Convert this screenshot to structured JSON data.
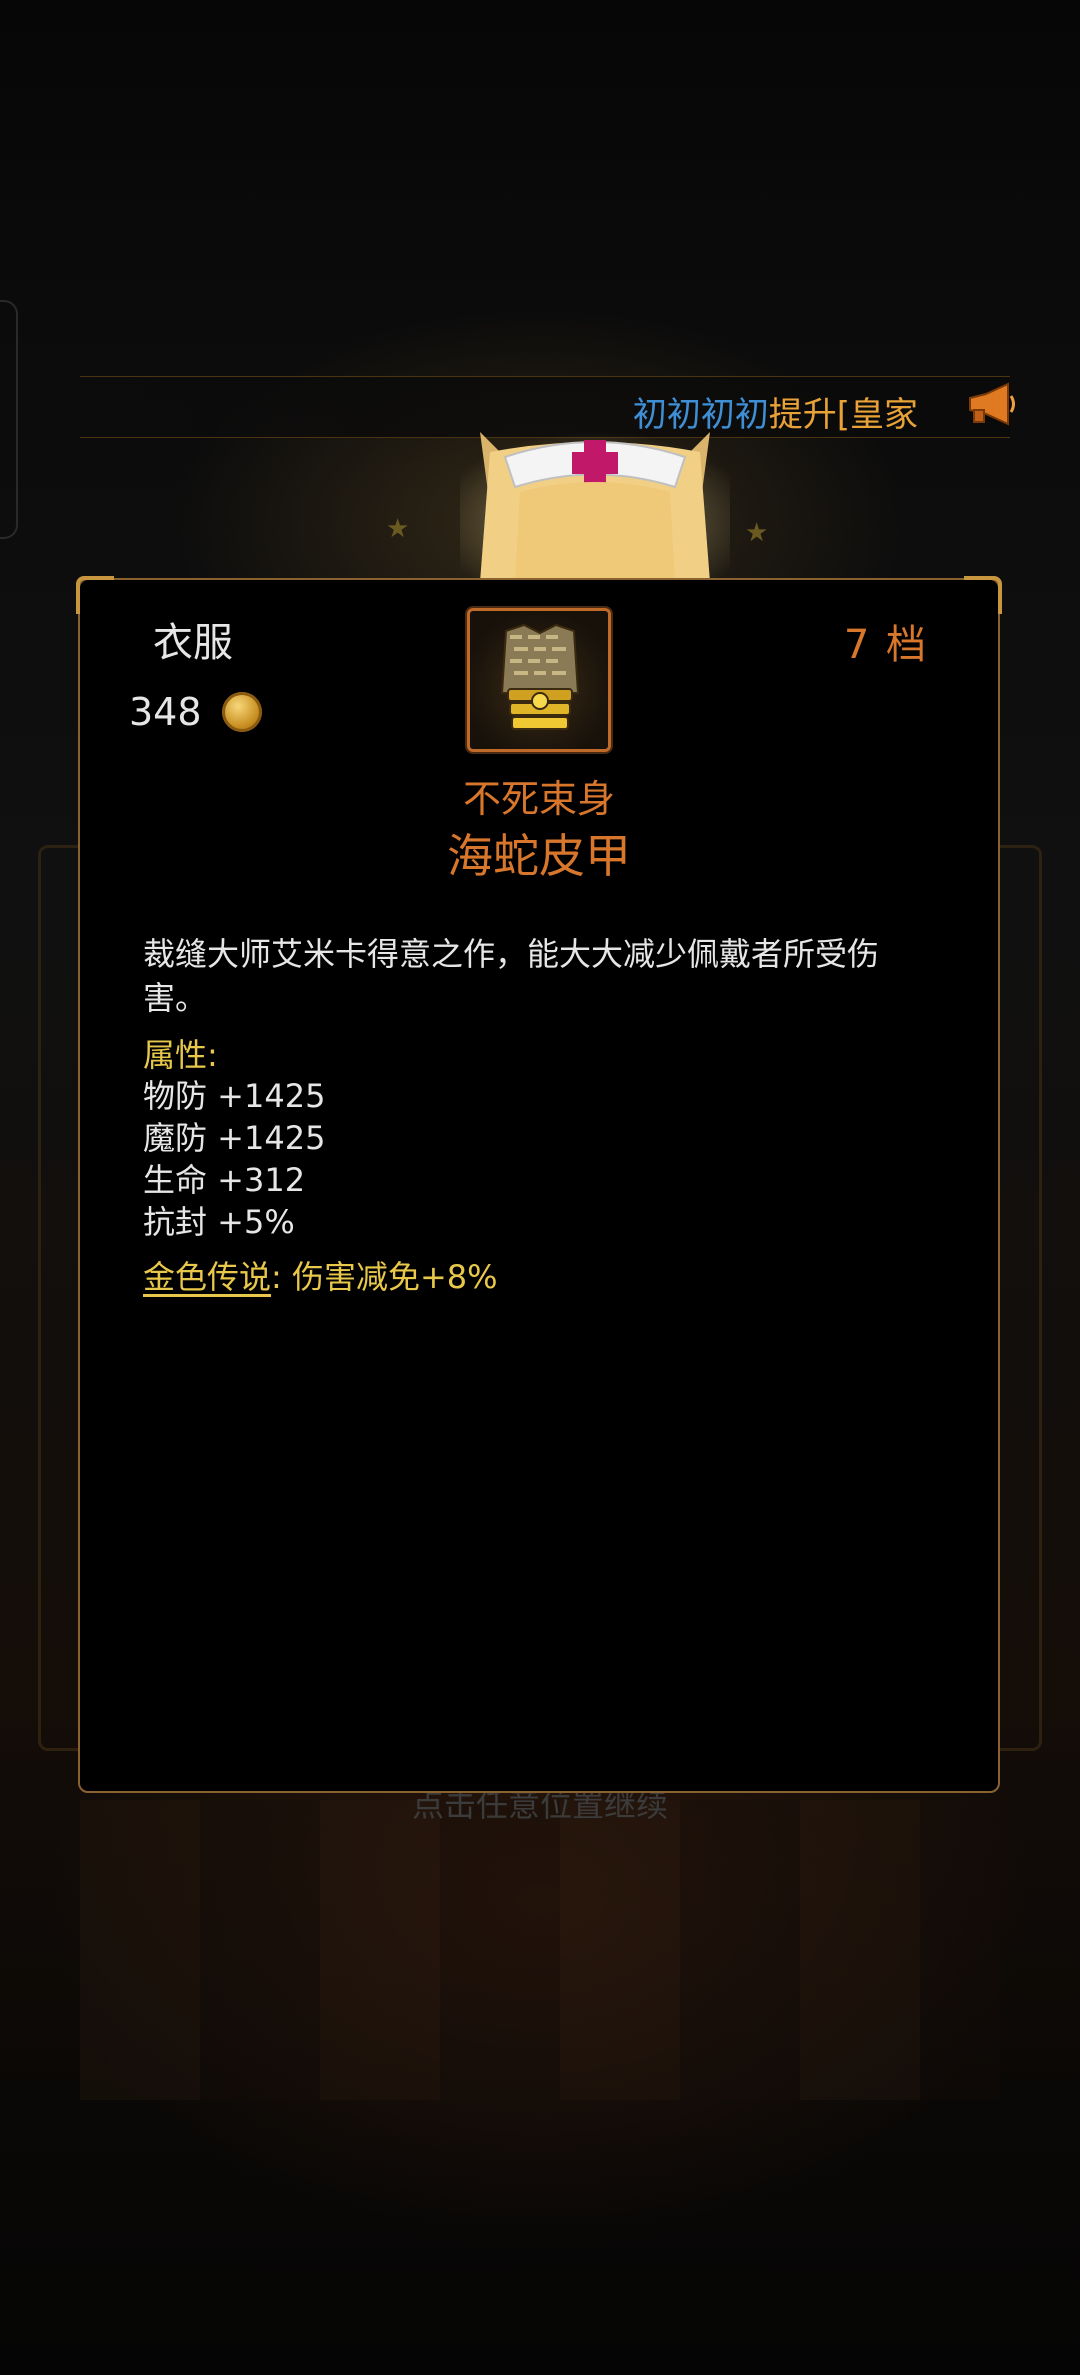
{
  "marquee": {
    "player_name": "初初初初",
    "message": "提升[皇家"
  },
  "hint": "点击任意位置继续",
  "item": {
    "category": "衣服",
    "price": "348",
    "tier": "7 档",
    "prefix": "不死束身",
    "name": "海蛇皮甲",
    "description": "裁缝大师艾米卡得意之作，能大大减少佩戴者所受伤害。",
    "attributes_title": "属性:",
    "attributes": [
      "物防 +1425",
      "魔防 +1425",
      "生命 +312",
      "抗封 +5%"
    ],
    "legend_label": "金色传说",
    "legend_sep": ":",
    "legend_value": "伤害减免+8%"
  },
  "icons": [
    "horn-icon",
    "coin-icon",
    "armor-icon"
  ],
  "colors": {
    "accent": "#d8772c",
    "gold": "#e8c84a",
    "name_blue": "#3f8fd6",
    "border": "#8a6230"
  }
}
